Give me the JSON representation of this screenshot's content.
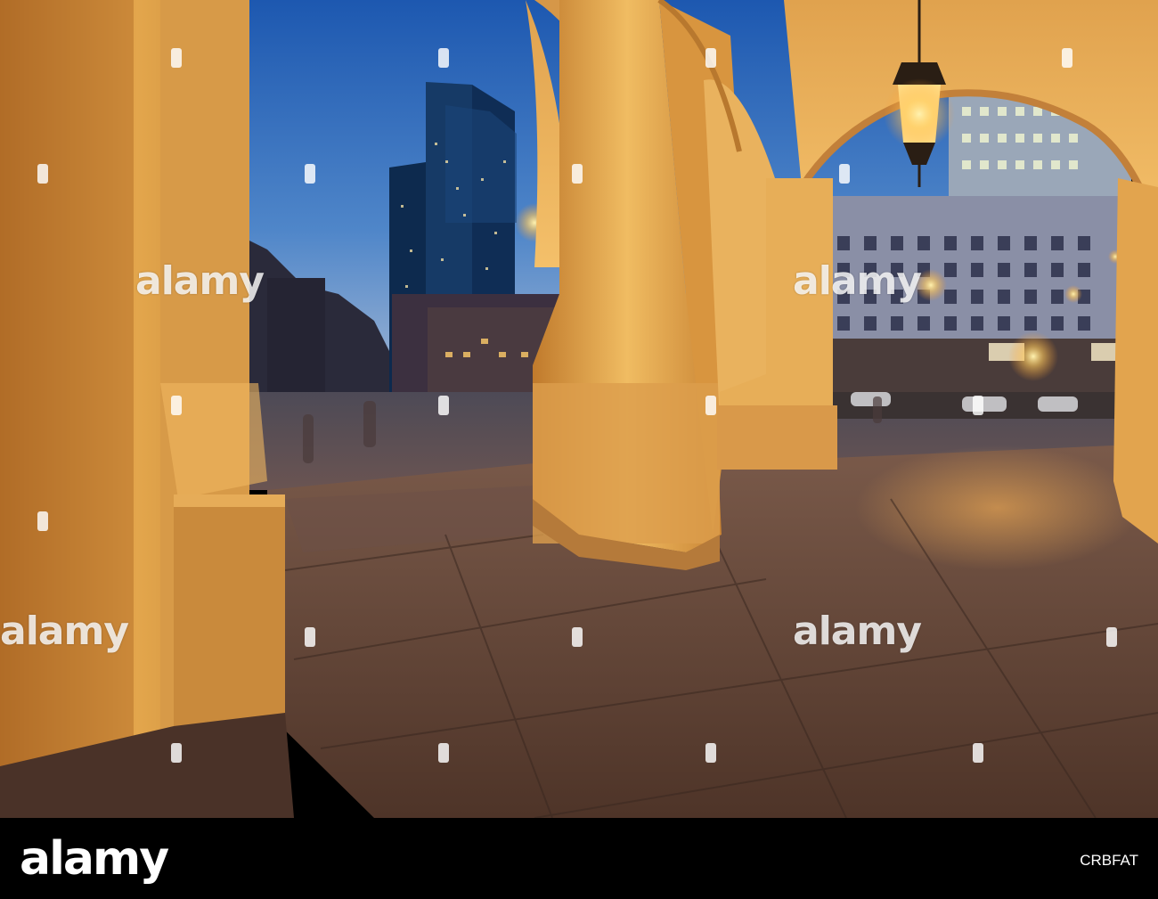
{
  "image": {
    "description_colors": {
      "sky_top": "#1f5fb8",
      "sky_bottom": "#9fb9d8",
      "stone_light": "#e8b25a",
      "stone_dark": "#9c5a1e",
      "floor": "#6a4a3c",
      "lamp_glow": "#ffd27a"
    }
  },
  "watermark": {
    "text": "alamy"
  },
  "footer": {
    "logo": "alamy",
    "image_id": "CRBFAT"
  }
}
